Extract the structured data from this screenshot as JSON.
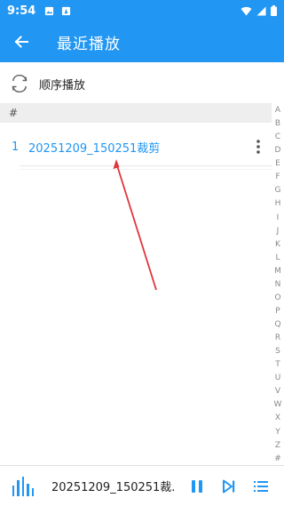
{
  "status_bar": {
    "time": "9:54"
  },
  "header": {
    "title": "最近播放"
  },
  "play_mode": {
    "label": "顺序播放"
  },
  "section": {
    "label": "#"
  },
  "songs": [
    {
      "index": "1",
      "title": "20251209_150251裁剪"
    }
  ],
  "index_letters": [
    "A",
    "B",
    "C",
    "D",
    "E",
    "F",
    "G",
    "H",
    "I",
    "J",
    "K",
    "L",
    "M",
    "N",
    "O",
    "P",
    "Q",
    "R",
    "S",
    "T",
    "U",
    "V",
    "W",
    "X",
    "Y",
    "Z",
    "#"
  ],
  "player": {
    "title": "20251209_150251裁..."
  },
  "colors": {
    "primary": "#2196f3",
    "annotation": "#e0353b"
  }
}
